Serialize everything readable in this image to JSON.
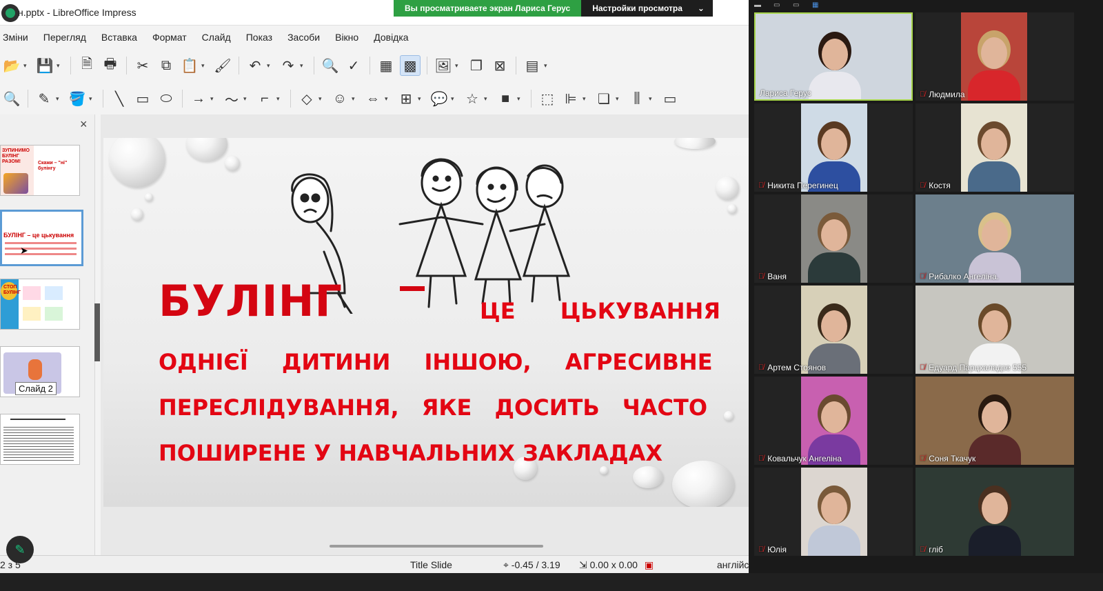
{
  "window": {
    "title": "н.pptx - LibreOffice Impress"
  },
  "share_banner": {
    "viewing_text": "Вы просматриваете экран Лариса Герус",
    "settings_label": "Настройки просмотра",
    "caret": "⌄"
  },
  "menu": [
    "Зміни",
    "Перегляд",
    "Вставка",
    "Формат",
    "Слайд",
    "Показ",
    "Засоби",
    "Вікно",
    "Довідка"
  ],
  "toolbar1": [
    {
      "icon": "open-folder-icon",
      "glyph": "📂"
    },
    {
      "icon": "save-icon",
      "glyph": "💾"
    },
    {
      "icon": "export-pdf-icon",
      "glyph": "🗎"
    },
    {
      "icon": "print-icon",
      "glyph": "🖶"
    },
    {
      "icon": "cut-icon",
      "glyph": "✂"
    },
    {
      "icon": "copy-icon",
      "glyph": "⧉"
    },
    {
      "icon": "paste-icon",
      "glyph": "📋"
    },
    {
      "icon": "clone-formatting-icon",
      "glyph": "🖌"
    },
    {
      "icon": "undo-icon",
      "glyph": "↶"
    },
    {
      "icon": "redo-icon",
      "glyph": "↷"
    },
    {
      "icon": "find-replace-icon",
      "glyph": "🔍"
    },
    {
      "icon": "spelling-icon",
      "glyph": "✓"
    },
    {
      "icon": "display-grid-icon",
      "glyph": "▦"
    },
    {
      "icon": "helplines-icon",
      "glyph": "▩"
    },
    {
      "icon": "insert-image-icon",
      "glyph": "🖼"
    },
    {
      "icon": "duplicate-slide-icon",
      "glyph": "❐"
    },
    {
      "icon": "delete-slide-icon",
      "glyph": "⊠"
    },
    {
      "icon": "slide-layout-icon",
      "glyph": "▤"
    }
  ],
  "toolbar2": [
    {
      "icon": "zoom-icon",
      "glyph": "🔍"
    },
    {
      "icon": "line-color-icon",
      "glyph": "✎"
    },
    {
      "icon": "fill-color-icon",
      "glyph": "🪣"
    },
    {
      "icon": "line-icon",
      "glyph": "╲"
    },
    {
      "icon": "rectangle-icon",
      "glyph": "▭"
    },
    {
      "icon": "ellipse-icon",
      "glyph": "⬭"
    },
    {
      "icon": "arrow-line-icon",
      "glyph": "→"
    },
    {
      "icon": "curve-icon",
      "glyph": "〜"
    },
    {
      "icon": "connector-icon",
      "glyph": "⌐"
    },
    {
      "icon": "basic-shapes-icon",
      "glyph": "◇"
    },
    {
      "icon": "symbol-shapes-icon",
      "glyph": "☺"
    },
    {
      "icon": "block-arrows-icon",
      "glyph": "⇔"
    },
    {
      "icon": "flowchart-icon",
      "glyph": "⊞"
    },
    {
      "icon": "callout-icon",
      "glyph": "💬"
    },
    {
      "icon": "stars-icon",
      "glyph": "☆"
    },
    {
      "icon": "3d-objects-icon",
      "glyph": "■"
    },
    {
      "icon": "transformations-icon",
      "glyph": "⬚"
    },
    {
      "icon": "align-icon",
      "glyph": "⊫"
    },
    {
      "icon": "arrange-icon",
      "glyph": "❏"
    },
    {
      "icon": "distribute-icon",
      "glyph": "⫼"
    },
    {
      "icon": "shadow-icon",
      "glyph": "▭"
    }
  ],
  "slide_panel": {
    "close": "×",
    "tooltip": "Слайд 2",
    "thumb1_texts": [
      "ЗУПИНИМО БУЛІНГ РАЗОМ!",
      "Скажи – \"ні\" булінгу"
    ],
    "thumb2_texts": [
      "БУЛІНГ – це цькування"
    ],
    "thumb3_texts": [
      "СТОП БУЛІНГ"
    ]
  },
  "slide": {
    "title_word": "БУЛІНГ",
    "line1": "ЦЕ ЦЬКУВАННЯ",
    "line2": "ОДНІЄЇ ДИТИНИ ІНШОЮ, АГРЕСИВНЕ",
    "line3": "ПЕРЕСЛІДУВАННЯ, ЯКЕ ДОСИТЬ ЧАСТО",
    "line4": "ПОШИРЕНЕ У НАВЧАЛЬНИХ ЗАКЛАДАХ"
  },
  "statusbar": {
    "page": "2 з 5",
    "layout": "Title Slide",
    "position": "-0.45 / 3.19",
    "size": "0.00 x 0.00",
    "language": "англійська (Сполучені Штати) (en-US)"
  },
  "participants": [
    {
      "name": "Лариса Герус",
      "muted": false,
      "active": true,
      "bg": "#cfd6de",
      "shirt": "#e8e8ee",
      "hair": "#2b1a12"
    },
    {
      "name": "Людмила",
      "muted": true,
      "active": false,
      "bg": "#b9453a",
      "shirt": "#d8262b",
      "hair": "#c8a36a"
    },
    {
      "name": "Никита Перегинец",
      "muted": true,
      "active": false,
      "bg": "#cfdbe6",
      "shirt": "#2d4fa0",
      "hair": "#5a3a22"
    },
    {
      "name": "Костя",
      "muted": true,
      "active": false,
      "bg": "#e7e3d2",
      "shirt": "#4a6a8a",
      "hair": "#6b4a2e"
    },
    {
      "name": "Ваня",
      "muted": true,
      "active": false,
      "bg": "#8a8a86",
      "shirt": "#2b3a3a",
      "hair": "#7a5a3a"
    },
    {
      "name": "Рибалко Ангеліна.",
      "muted": true,
      "active": false,
      "bg": "#6c7f8c",
      "shirt": "#c9c3d6",
      "hair": "#d9c08a"
    },
    {
      "name": "Артем Стоянов",
      "muted": true,
      "active": false,
      "bg": "#d7d0b8",
      "shirt": "#6a6f78",
      "hair": "#3a2a1a"
    },
    {
      "name": "Едуард Парцхаладзе 555",
      "muted": true,
      "active": false,
      "bg": "#c7c6c0",
      "shirt": "#f2f2f2",
      "hair": "#6a4a2a"
    },
    {
      "name": "Ковальчук Ангеліна",
      "muted": true,
      "active": false,
      "bg": "#c860b0",
      "shirt": "#7a3aa0",
      "hair": "#6a4a30"
    },
    {
      "name": "Соня Ткачук",
      "muted": true,
      "active": false,
      "bg": "#8a6a4a",
      "shirt": "#5a2a2a",
      "hair": "#2a1a10"
    },
    {
      "name": "Юлія",
      "muted": true,
      "active": false,
      "bg": "#dcd6d0",
      "shirt": "#c0c8d8",
      "hair": "#7a5a3a"
    },
    {
      "name": "гліб",
      "muted": true,
      "active": false,
      "bg": "#2e3a34",
      "shirt": "#1a1e2a",
      "hair": "#4a3020"
    }
  ],
  "colors": {
    "slide_red": "#e30613",
    "share_green": "#2ea043",
    "active_speaker_border": "#a7d54a",
    "mic_muted": "#e02828"
  }
}
